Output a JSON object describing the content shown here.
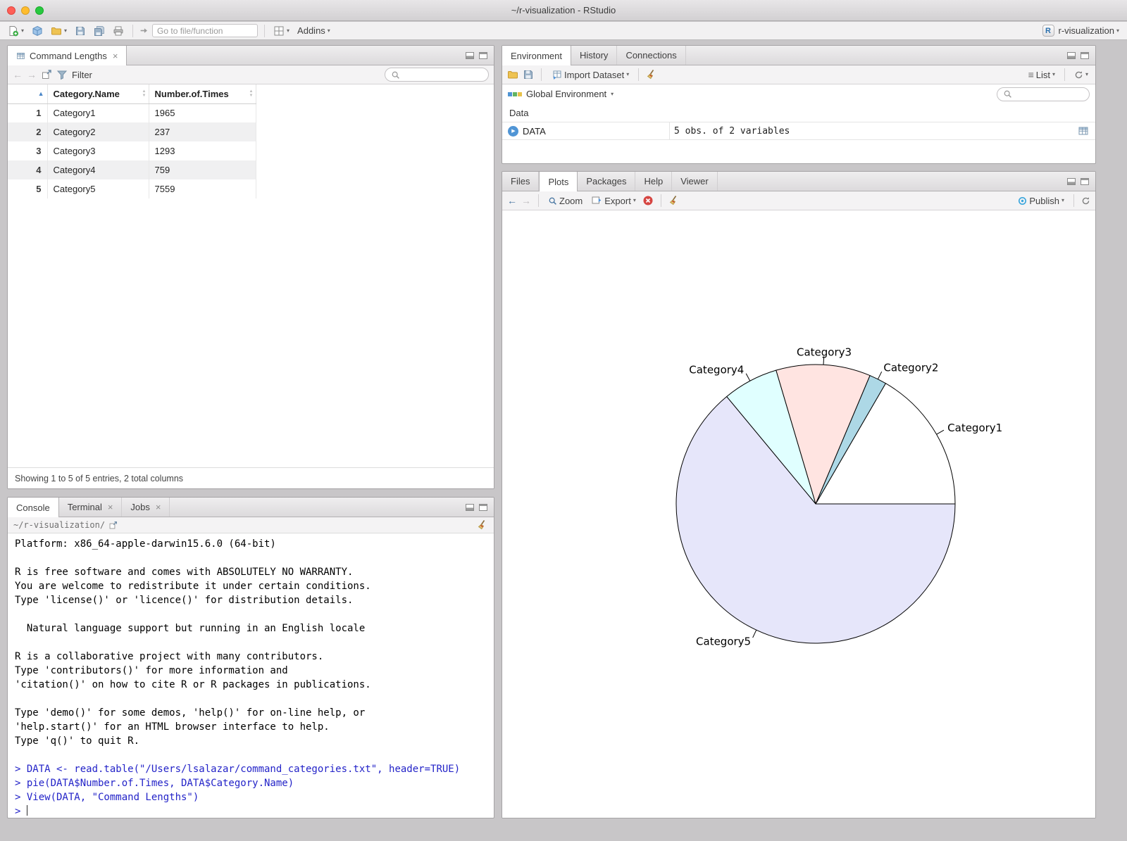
{
  "window": {
    "title": "~/r-visualization - RStudio"
  },
  "icons": {
    "r_letter": "R",
    "close": "×",
    "caret_down": "▾",
    "back_arrow": "←",
    "forward_arrow": "→",
    "list": "≡",
    "play": "▶",
    "sort_up": "▲",
    "sort_down": "▼"
  },
  "main_toolbar": {
    "goto_placeholder": "Go to file/function",
    "addins_label": "Addins",
    "project_label": "r-visualization"
  },
  "data_viewer": {
    "tab_title": "Command Lengths",
    "filter_label": "Filter",
    "table": {
      "columns": [
        "Category.Name",
        "Number.of.Times"
      ],
      "rows": [
        {
          "num": "1",
          "name": "Category1",
          "times": "1965"
        },
        {
          "num": "2",
          "name": "Category2",
          "times": "237"
        },
        {
          "num": "3",
          "name": "Category3",
          "times": "1293"
        },
        {
          "num": "4",
          "name": "Category4",
          "times": "759"
        },
        {
          "num": "5",
          "name": "Category5",
          "times": "7559"
        }
      ]
    },
    "footer": "Showing 1 to 5 of 5 entries, 2 total columns"
  },
  "console": {
    "tabs": [
      {
        "label": "Console"
      },
      {
        "label": "Terminal"
      },
      {
        "label": "Jobs"
      }
    ],
    "path": "~/r-visualization/",
    "lines": [
      {
        "type": "output",
        "text": "Platform: x86_64-apple-darwin15.6.0 (64-bit)"
      },
      {
        "type": "output",
        "text": ""
      },
      {
        "type": "output",
        "text": "R is free software and comes with ABSOLUTELY NO WARRANTY."
      },
      {
        "type": "output",
        "text": "You are welcome to redistribute it under certain conditions."
      },
      {
        "type": "output",
        "text": "Type 'license()' or 'licence()' for distribution details."
      },
      {
        "type": "output",
        "text": ""
      },
      {
        "type": "output",
        "text": "  Natural language support but running in an English locale"
      },
      {
        "type": "output",
        "text": ""
      },
      {
        "type": "output",
        "text": "R is a collaborative project with many contributors."
      },
      {
        "type": "output",
        "text": "Type 'contributors()' for more information and"
      },
      {
        "type": "output",
        "text": "'citation()' on how to cite R or R packages in publications."
      },
      {
        "type": "output",
        "text": ""
      },
      {
        "type": "output",
        "text": "Type 'demo()' for some demos, 'help()' for on-line help, or"
      },
      {
        "type": "output",
        "text": "'help.start()' for an HTML browser interface to help."
      },
      {
        "type": "output",
        "text": "Type 'q()' to quit R."
      },
      {
        "type": "output",
        "text": ""
      },
      {
        "type": "command",
        "text": "> DATA <- read.table(\"/Users/lsalazar/command_categories.txt\", header=TRUE)"
      },
      {
        "type": "command",
        "text": "> pie(DATA$Number.of.Times, DATA$Category.Name)"
      },
      {
        "type": "command",
        "text": "> View(DATA, \"Command Lengths\")"
      },
      {
        "type": "prompt",
        "text": "> "
      }
    ]
  },
  "environment": {
    "tabs": [
      "Environment",
      "History",
      "Connections"
    ],
    "import_label": "Import Dataset",
    "list_label": "List",
    "scope_label": "Global Environment",
    "section_label": "Data",
    "objects": [
      {
        "name": "DATA",
        "value": "5 obs. of 2 variables"
      }
    ]
  },
  "plots": {
    "tabs": [
      "Files",
      "Plots",
      "Packages",
      "Help",
      "Viewer"
    ],
    "zoom_label": "Zoom",
    "export_label": "Export",
    "publish_label": "Publish"
  },
  "chart_data": {
    "type": "pie",
    "title": "",
    "categories": [
      "Category1",
      "Category2",
      "Category3",
      "Category4",
      "Category5"
    ],
    "values": [
      1965,
      237,
      1293,
      759,
      7559
    ],
    "colors": [
      "#FFFFFF",
      "#ADD8E6",
      "#FFE4E1",
      "#E0FFFF",
      "#E6E6FA"
    ],
    "stroke": "#000000",
    "start_angle_deg": 0,
    "direction": "counterclockwise",
    "labels_position": "outside",
    "legend": false
  }
}
